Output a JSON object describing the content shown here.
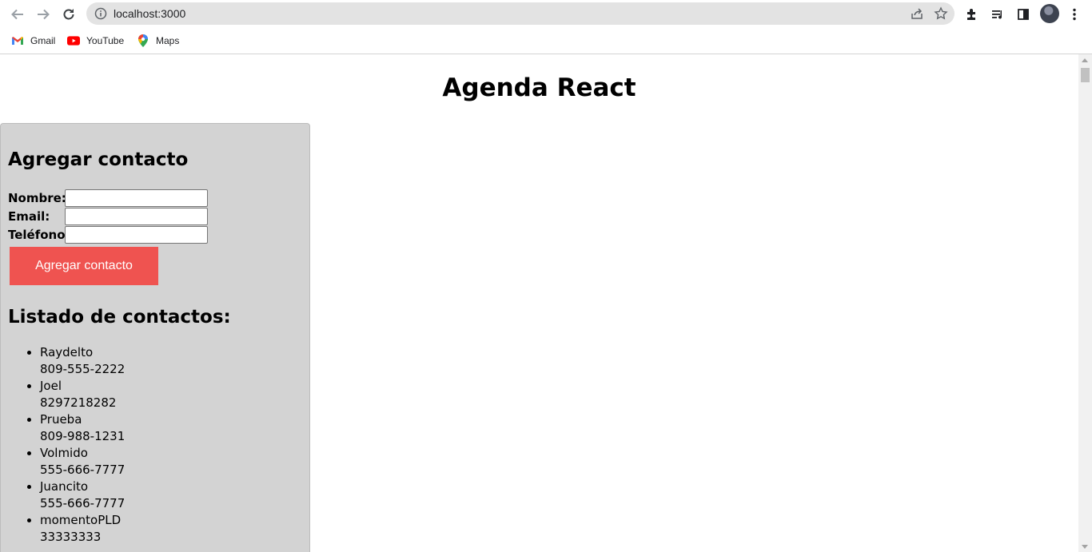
{
  "browser": {
    "url": "localhost:3000",
    "bookmarks": [
      {
        "label": "Gmail",
        "icon": "gmail-icon"
      },
      {
        "label": "YouTube",
        "icon": "youtube-icon"
      },
      {
        "label": "Maps",
        "icon": "maps-icon"
      }
    ]
  },
  "page": {
    "title": "Agenda React",
    "form": {
      "heading": "Agregar contacto",
      "name_label": "Nombre:",
      "name_value": "",
      "email_label": "Email:",
      "email_value": "",
      "phone_label": "Teléfono:",
      "phone_value": "",
      "submit_label": "Agregar contacto"
    },
    "list": {
      "heading": "Listado de contactos:",
      "contacts": [
        {
          "name": "Raydelto",
          "phone": "809-555-2222"
        },
        {
          "name": "Joel",
          "phone": "8297218282"
        },
        {
          "name": "Prueba",
          "phone": "809-988-1231"
        },
        {
          "name": "Volmido",
          "phone": "555-666-7777"
        },
        {
          "name": "Juancito",
          "phone": "555-666-7777"
        },
        {
          "name": "momentoPLD",
          "phone": "33333333"
        }
      ]
    }
  },
  "colors": {
    "button_bg": "#ef5350",
    "panel_bg": "#d3d3d3"
  }
}
